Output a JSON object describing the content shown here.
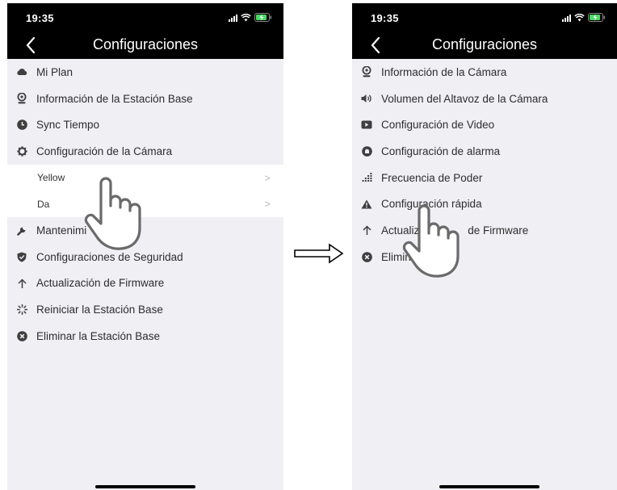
{
  "left_screen": {
    "status": {
      "time": "19:35"
    },
    "title": "Configuraciones",
    "items": [
      {
        "label": "Mi Plan",
        "icon": "cloud-icon"
      },
      {
        "label": "Información de la Estación Base",
        "icon": "webcam-icon"
      },
      {
        "label": "Sync Tiempo",
        "icon": "clock-icon"
      },
      {
        "label": "Configuración de la Cámara",
        "icon": "gear-icon"
      },
      {
        "label": "Yellow",
        "icon": "chevron-right-icon"
      },
      {
        "label": "Da",
        "icon": "chevron-right-icon"
      },
      {
        "label": "Mantenimi",
        "icon": "wrench-icon"
      },
      {
        "label": "Configuraciones de Seguridad",
        "icon": "shield-icon"
      },
      {
        "label": "Actualización de Firmware",
        "icon": "arrow-up-icon"
      },
      {
        "label": "Reiniciar la Estación Base",
        "icon": "reboot-spinner-icon"
      },
      {
        "label": "Eliminar la Estación Base",
        "icon": "close-circle-icon"
      }
    ]
  },
  "right_screen": {
    "status": {
      "time": "19:35"
    },
    "title": "Configuraciones",
    "items": [
      {
        "label": "Información de la Cámara",
        "icon": "webcam-icon"
      },
      {
        "label": "Volumen del Altavoz de la Cámara",
        "icon": "speaker-icon"
      },
      {
        "label": "Configuración de Video",
        "icon": "video-icon"
      },
      {
        "label": "Configuración de alarma",
        "icon": "alarm-icon"
      },
      {
        "label": "Frecuencia de Poder",
        "icon": "frequency-bars-icon"
      },
      {
        "label": "Configuración rápida",
        "icon": "warning-triangle-icon"
      },
      {
        "label": "Actualiz",
        "label_end": "de Firmware",
        "icon": "arrow-up-icon"
      },
      {
        "label": "Elimin",
        "icon": "close-circle-icon"
      }
    ]
  },
  "colors": {
    "bar": "#000000",
    "list_bg": "#efeff4",
    "text": "#2e2e2e",
    "icon": "#3f3f3f"
  }
}
